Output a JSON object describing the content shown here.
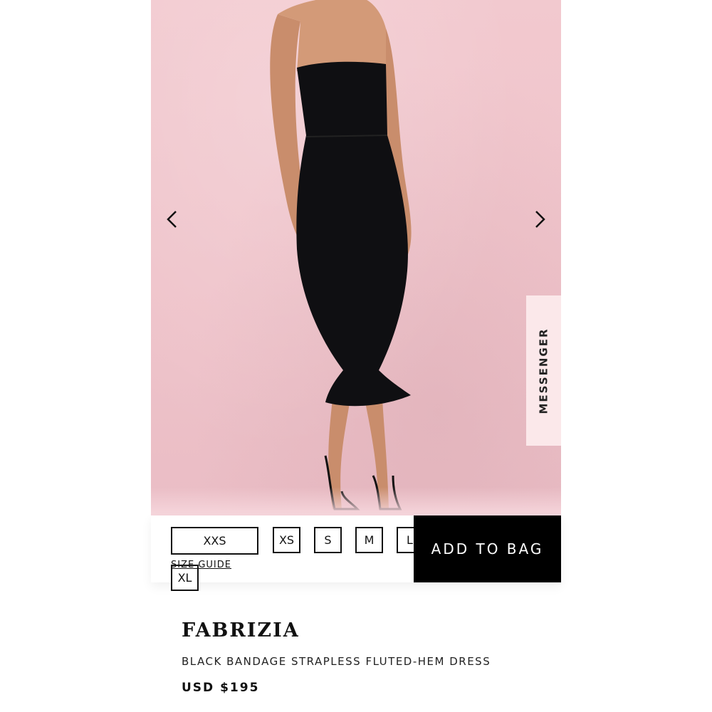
{
  "gallery": {
    "prev_icon": "chevron-left-icon",
    "next_icon": "chevron-right-icon",
    "background_color": "#efc3ca"
  },
  "messenger": {
    "label": "MESSENGER"
  },
  "sizes": {
    "options": [
      "XXS",
      "XS",
      "S",
      "M",
      "L",
      "XL"
    ],
    "guide_label": "SIZE GUIDE"
  },
  "cart": {
    "add_label": "ADD TO BAG"
  },
  "product": {
    "name": "FABRIZIA",
    "description": "BLACK BANDAGE STRAPLESS FLUTED-HEM DRESS",
    "price": "USD $195"
  }
}
